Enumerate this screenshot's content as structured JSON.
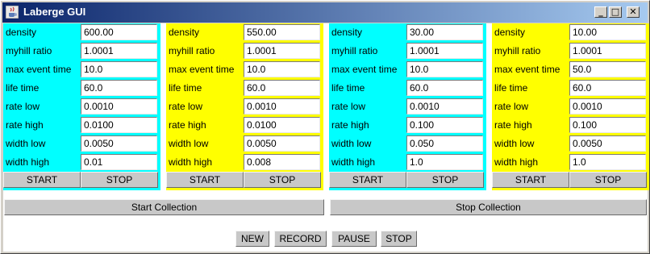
{
  "window": {
    "title": "Laberge GUI",
    "minimize": "_",
    "maximize": "□",
    "close": "✕"
  },
  "labels": {
    "density": "density",
    "myhill_ratio": "myhill ratio",
    "max_event_time": "max event time",
    "life_time": "life time",
    "rate_low": "rate low",
    "rate_high": "rate high",
    "width_low": "width low",
    "width_high": "width high"
  },
  "panels": [
    {
      "color": "#00ffff",
      "values": {
        "density": "600.00",
        "myhill_ratio": "1.0001",
        "max_event_time": "10.0",
        "life_time": "60.0",
        "rate_low": "0.0010",
        "rate_high": "0.0100",
        "width_low": "0.0050",
        "width_high": "0.01"
      },
      "start": "START",
      "stop": "STOP"
    },
    {
      "color": "#ffff00",
      "values": {
        "density": "550.00",
        "myhill_ratio": "1.0001",
        "max_event_time": "10.0",
        "life_time": "60.0",
        "rate_low": "0.0010",
        "rate_high": "0.0100",
        "width_low": "0.0050",
        "width_high": "0.008"
      },
      "start": "START",
      "stop": "STOP"
    },
    {
      "color": "#00ffff",
      "values": {
        "density": "30.00",
        "myhill_ratio": "1.0001",
        "max_event_time": "10.0",
        "life_time": "60.0",
        "rate_low": "0.0010",
        "rate_high": "0.100",
        "width_low": "0.050",
        "width_high": "1.0"
      },
      "start": "START",
      "stop": "STOP"
    },
    {
      "color": "#ffff00",
      "values": {
        "density": "10.00",
        "myhill_ratio": "1.0001",
        "max_event_time": "50.0",
        "life_time": "60.0",
        "rate_low": "0.0010",
        "rate_high": "0.100",
        "width_low": "0.0050",
        "width_high": "1.0"
      },
      "start": "START",
      "stop": "STOP"
    }
  ],
  "collection": {
    "start": "Start Collection",
    "stop": "Stop Collection"
  },
  "controls": {
    "new": "NEW",
    "record": "RECORD",
    "pause": "PAUSE",
    "stop": "STOP"
  }
}
